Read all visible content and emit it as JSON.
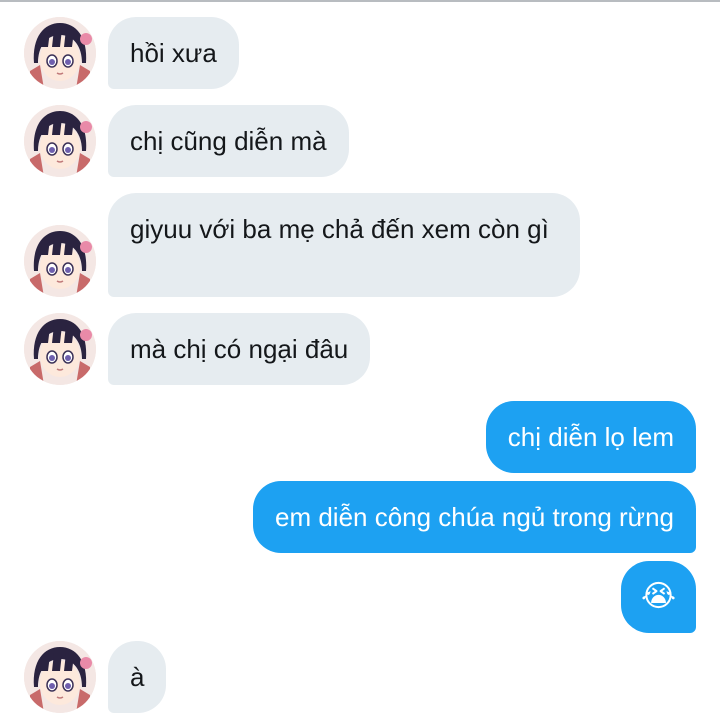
{
  "conversation": {
    "messages": [
      {
        "direction": "incoming",
        "text": "hồi xưa"
      },
      {
        "direction": "incoming",
        "text": "chị cũng diễn mà"
      },
      {
        "direction": "incoming",
        "text": "giyuu với ba mẹ chả đến xem còn gì"
      },
      {
        "direction": "incoming",
        "text": "mà chị có ngại đâu"
      },
      {
        "direction": "outgoing",
        "text": "chị diễn lọ lem"
      },
      {
        "direction": "outgoing",
        "text": "em diễn công chúa ngủ trong rừng"
      },
      {
        "direction": "outgoing",
        "text": "😭"
      },
      {
        "direction": "incoming",
        "text": "à"
      }
    ]
  },
  "colors": {
    "incoming_bubble": "#e6ecf0",
    "outgoing_bubble": "#1da1f2",
    "incoming_text": "#14171a",
    "outgoing_text": "#ffffff"
  },
  "icons": {
    "avatar": "anime-girl-avatar-icon",
    "crying_emoji": "crying-face-emoji"
  }
}
